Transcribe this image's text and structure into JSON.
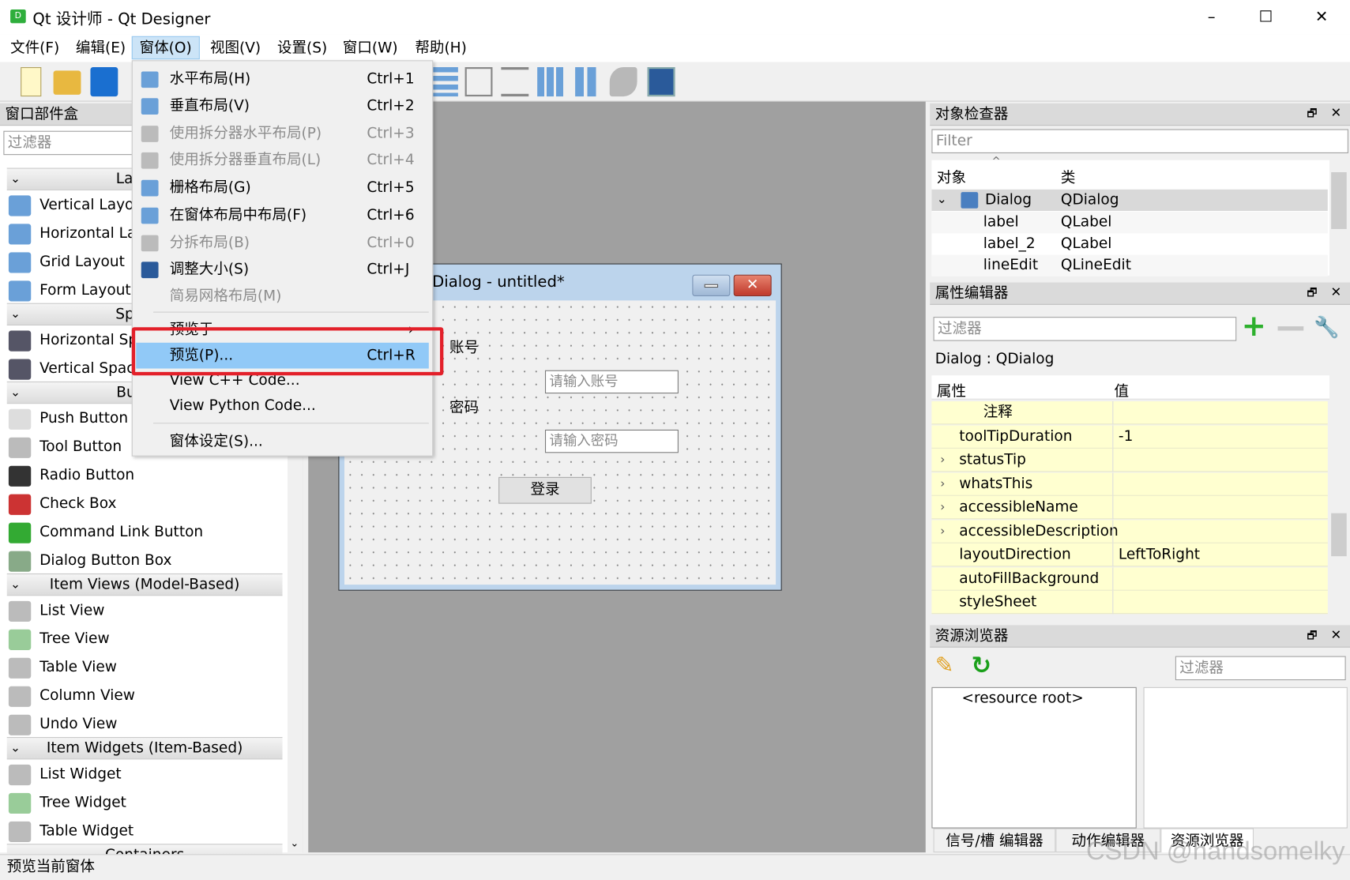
{
  "window": {
    "title": "Qt 设计师 - Qt Designer",
    "app_icon_letter": "D",
    "minimize": "–",
    "maximize": "☐",
    "close": "✕"
  },
  "menubar": [
    "文件(F)",
    "编辑(E)",
    "窗体(O)",
    "视图(V)",
    "设置(S)",
    "窗口(W)",
    "帮助(H)"
  ],
  "open_menu": {
    "items": [
      {
        "label": "水平布局(H)",
        "shortcut": "Ctrl+1",
        "enabled": true
      },
      {
        "label": "垂直布局(V)",
        "shortcut": "Ctrl+2",
        "enabled": true
      },
      {
        "label": "使用拆分器水平布局(P)",
        "shortcut": "Ctrl+3",
        "enabled": false
      },
      {
        "label": "使用拆分器垂直布局(L)",
        "shortcut": "Ctrl+4",
        "enabled": false
      },
      {
        "label": "栅格布局(G)",
        "shortcut": "Ctrl+5",
        "enabled": true
      },
      {
        "label": "在窗体布局中布局(F)",
        "shortcut": "Ctrl+6",
        "enabled": true
      },
      {
        "label": "分拆布局(B)",
        "shortcut": "Ctrl+0",
        "enabled": false
      },
      {
        "label": "调整大小(S)",
        "shortcut": "Ctrl+J",
        "enabled": true
      },
      {
        "label": "简易网格布局(M)",
        "shortcut": "",
        "enabled": false
      },
      {
        "label": "预览于",
        "shortcut": "",
        "enabled": true,
        "submenu_arrow": "›"
      },
      {
        "label": "预览(P)...",
        "shortcut": "Ctrl+R",
        "enabled": true,
        "highlighted": true
      },
      {
        "label": "View C++ Code...",
        "shortcut": "",
        "enabled": true
      },
      {
        "label": "View Python Code...",
        "shortcut": "",
        "enabled": true
      },
      {
        "label": "窗体设定(S)...",
        "shortcut": "",
        "enabled": true
      }
    ],
    "highlight_color": "#91c9f7",
    "annotation_color": "#e3202a"
  },
  "widget_box": {
    "title": "窗口部件盒",
    "filter_placeholder": "过滤器",
    "categories": [
      {
        "label": "Layouts",
        "items": [
          "Vertical Layout",
          "Horizontal Layout",
          "Grid Layout",
          "Form Layout"
        ]
      },
      {
        "label": "Spacers",
        "items": [
          "Horizontal Spacer",
          "Vertical Spacer"
        ]
      },
      {
        "label": "Buttons",
        "items": [
          "Push Button",
          "Tool Button",
          "Radio Button",
          "Check Box",
          "Command Link Button",
          "Dialog Button Box"
        ]
      },
      {
        "label": "Item Views (Model-Based)",
        "items": [
          "List View",
          "Tree View",
          "Table View",
          "Column View",
          "Undo View"
        ]
      },
      {
        "label": "Item Widgets (Item-Based)",
        "items": [
          "List Widget",
          "Tree Widget",
          "Table Widget"
        ]
      },
      {
        "label": "Containers",
        "items": []
      }
    ]
  },
  "form": {
    "title": "Dialog - untitled*",
    "label1": "账号",
    "label2": "密码",
    "input1_placeholder": "请输入账号",
    "input2_placeholder": "请输入密码",
    "button": "登录"
  },
  "object_inspector": {
    "title": "对象检查器",
    "filter_placeholder": "Filter",
    "col_object": "对象",
    "col_class": "类",
    "rows": [
      {
        "object": "Dialog",
        "class": "QDialog"
      },
      {
        "object": "label",
        "class": "QLabel"
      },
      {
        "object": "label_2",
        "class": "QLabel"
      },
      {
        "object": "lineEdit",
        "class": "QLineEdit"
      }
    ]
  },
  "property_editor": {
    "title": "属性编辑器",
    "filter_placeholder": "过滤器",
    "context": "Dialog : QDialog",
    "col_property": "属性",
    "col_value": "值",
    "rows": [
      {
        "name": "注释",
        "value": "",
        "expandable": false
      },
      {
        "name": "toolTipDuration",
        "value": "-1",
        "expandable": false
      },
      {
        "name": "statusTip",
        "value": "",
        "expandable": true
      },
      {
        "name": "whatsThis",
        "value": "",
        "expandable": true
      },
      {
        "name": "accessibleName",
        "value": "",
        "expandable": true
      },
      {
        "name": "accessibleDescription",
        "value": "",
        "expandable": true
      },
      {
        "name": "layoutDirection",
        "value": "LeftToRight",
        "expandable": false
      },
      {
        "name": "autoFillBackground",
        "value": "",
        "checkbox": false,
        "expandable": false
      },
      {
        "name": "styleSheet",
        "value": "",
        "expandable": false
      }
    ]
  },
  "resource_browser": {
    "title": "资源浏览器",
    "filter_placeholder": "过滤器",
    "root": "<resource root>"
  },
  "bottom_tabs": [
    "信号/槽 编辑器",
    "动作编辑器",
    "资源浏览器"
  ],
  "status_bar": "预览当前窗体",
  "watermark": "CSDN @handsomelky"
}
